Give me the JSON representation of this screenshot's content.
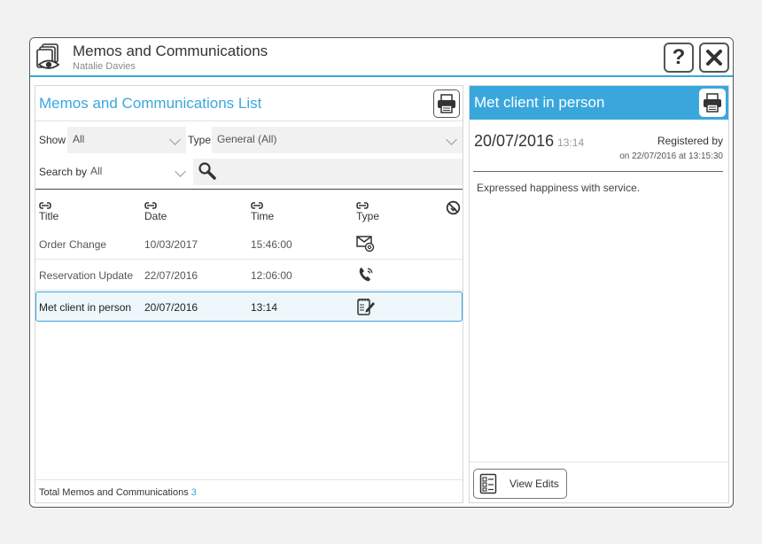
{
  "window": {
    "title": "Memos and Communications",
    "subtitle": "Natalie Davies",
    "help_label": "?"
  },
  "list_panel": {
    "title": "Memos and Communications List",
    "filters": {
      "show_label": "Show",
      "show_value": "All",
      "type_label": "Type",
      "type_value": "General (All)",
      "search_by_label": "Search by",
      "search_by_value": "All",
      "search_value": ""
    },
    "columns": [
      "Title",
      "Date",
      "Time",
      "Type"
    ],
    "rows": [
      {
        "title": "Order Change",
        "date": "10/03/2017",
        "time": "15:46:00",
        "type_icon": "email-icon",
        "selected": false
      },
      {
        "title": "Reservation Update",
        "date": "22/07/2016",
        "time": "12:06:00",
        "type_icon": "phone-icon",
        "selected": false
      },
      {
        "title": "Met client in person",
        "date": "20/07/2016",
        "time": "13:14",
        "type_icon": "notepad-icon",
        "selected": true
      }
    ],
    "footer_label": "Total Memos and Communications",
    "footer_count": "3"
  },
  "detail_panel": {
    "title": "Met client in person",
    "date": "20/07/2016",
    "time": "13:14",
    "registered_label": "Registered by",
    "registered_on": "on 22/07/2016 at 13:15:30",
    "body": "Expressed happiness with service.",
    "view_edits_label": "View Edits"
  },
  "colors": {
    "accent": "#3aa7dc",
    "selected_row_bg": "#edf7fc"
  }
}
